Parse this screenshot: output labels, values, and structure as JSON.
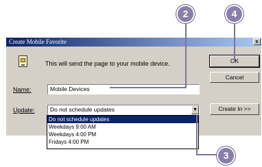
{
  "dialog": {
    "title": "Create Mobile Favorite",
    "close_glyph": "x",
    "message": "This will send the page to your mobile device.",
    "name_label": "Name:",
    "name_value": "Mobile Devices",
    "update_label": "Update:",
    "update_value": "Do not schedule updates",
    "arrow_glyph": "▼",
    "buttons": {
      "ok": "OK",
      "cancel": "Cancel",
      "create": "Create In >>"
    },
    "dropdown_options": [
      "Do not schedule updates",
      "Weekdays 9:00 AM",
      "Weekdays 4:00 PM",
      "Fridays 4:00 PM"
    ]
  },
  "callouts": [
    "2",
    "4",
    "3"
  ],
  "colors": {
    "titlebar_start": "#0a246a",
    "titlebar_end": "#a6caf0",
    "dialog_face": "#d4d0c8",
    "selection": "#0a246a",
    "callout_fill": "#8a7fa8"
  }
}
